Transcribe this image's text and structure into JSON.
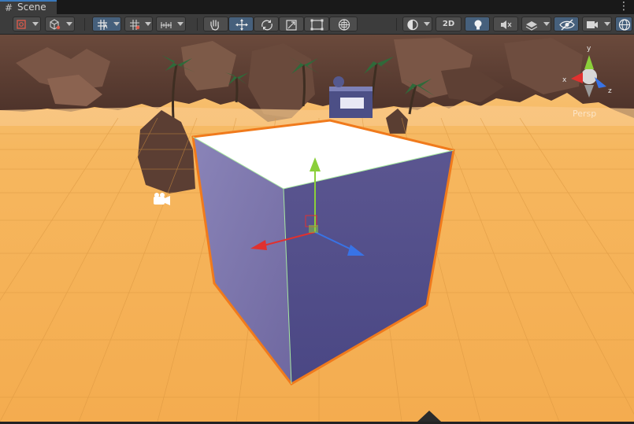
{
  "window": {
    "tab_label": "Scene",
    "tab_icon": "hash-grid-icon",
    "more_menu_icon": "vertical-dots-icon"
  },
  "toolbar": {
    "two_d_label": "2D",
    "accent_color": "#46607c",
    "tools": [
      "draw-mode-dropdown",
      "render-shading-dropdown",
      "grid-snap-toggle",
      "grid-dropdown",
      "increment-snap-dropdown",
      "hand-tool",
      "move-tool",
      "rotate-tool",
      "scale-tool",
      "rect-tool",
      "transform-tool",
      "shading-mode-dropdown",
      "2d-toggle",
      "lighting-toggle",
      "audio-toggle",
      "effects-dropdown",
      "hidden-objects-toggle",
      "camera-dropdown",
      "gizmos-toggle"
    ]
  },
  "scene": {
    "projection_label": "Persp",
    "ground_color": "#f6b45e",
    "grid_line_color": "#d9953f",
    "selected_outline_color": "#f07a1c",
    "cube_side_color": "#6e689a",
    "cube_top_color": "#ffffff",
    "axis_gizmo": {
      "x_label": "x",
      "y_label": "y",
      "z_label": "z",
      "x_color": "#e0312f",
      "y_color": "#8bcf3a",
      "z_color": "#3873e6"
    }
  }
}
